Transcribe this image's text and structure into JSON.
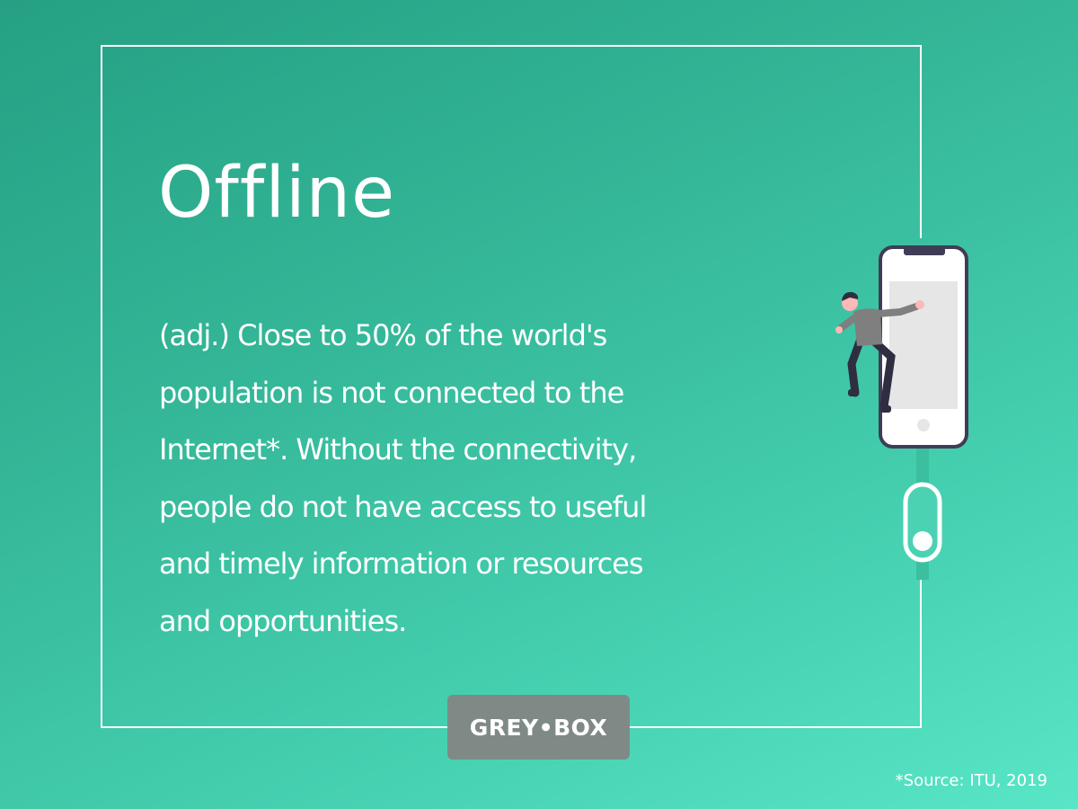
{
  "title": "Offline",
  "description_lines": [
    "(adj.) Close to 50% of the world's",
    "population is not connected to the",
    "Internet*. Without the connectivity,",
    "people do not have access to useful",
    "and timely information or resources",
    "and opportunities."
  ],
  "brand": "GREY•BOX",
  "source": "*Source: ITU, 2019",
  "colors": {
    "background_start": "#25a083",
    "background_end": "#58e6c7",
    "text": "#ffffff",
    "badge": "#7f8a86",
    "phone_outline": "#3f3d56"
  },
  "icons": {
    "illustration": "person-climbing-phone-illustration",
    "toggle": "toggle-switch-icon"
  }
}
